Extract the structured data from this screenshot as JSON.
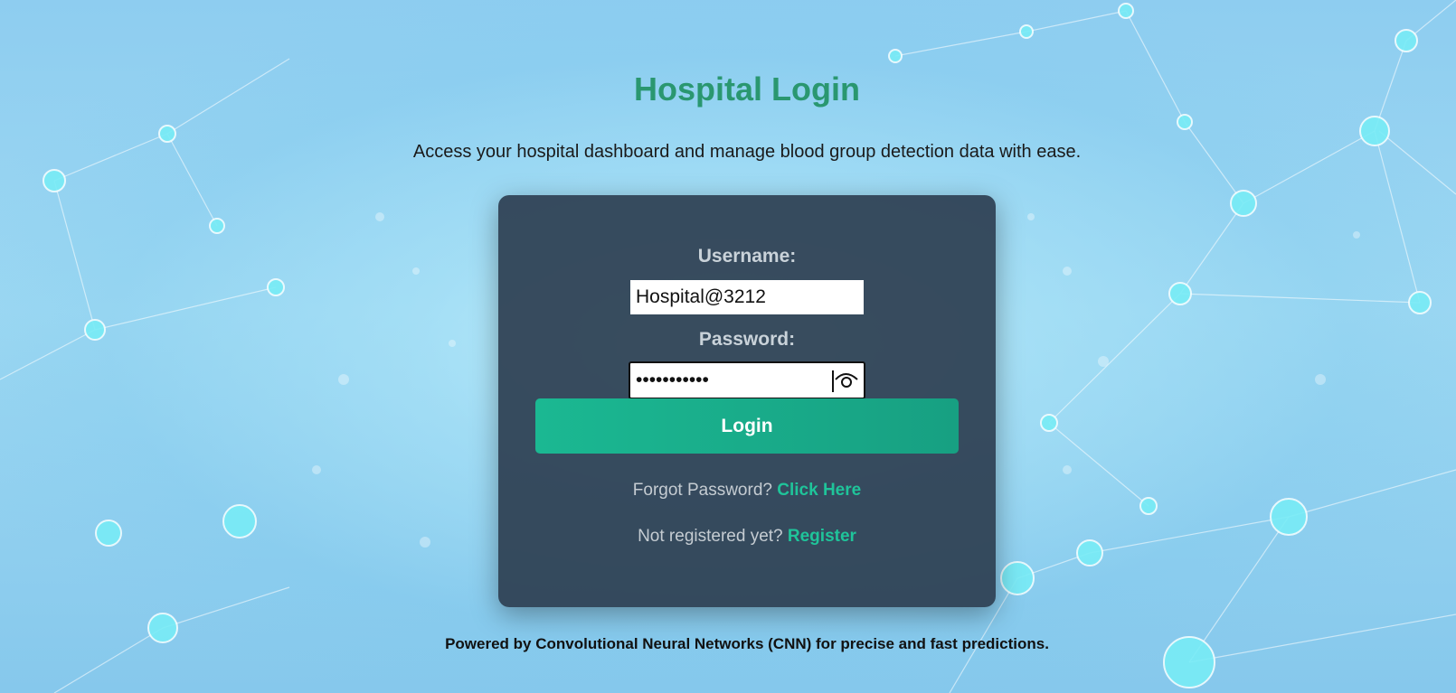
{
  "page": {
    "title": "Hospital Login",
    "subtitle": "Access your hospital dashboard and manage blood group detection data with ease."
  },
  "form": {
    "username_label": "Username:",
    "username_value": "Hospital@3212",
    "password_label": "Password:",
    "password_value": "•••••••••••",
    "show_password_icon": "eye-icon",
    "login_label": "Login"
  },
  "links": {
    "forgot_text": "Forgot Password?",
    "forgot_link": "Click Here",
    "register_text": "Not registered yet?",
    "register_link": "Register"
  },
  "footer": {
    "text": "Powered by Convolutional Neural Networks (CNN) for precise and fast predictions."
  },
  "colors": {
    "accent": "#1fc49a",
    "title": "#2a9770",
    "card": "#2d3e50"
  }
}
